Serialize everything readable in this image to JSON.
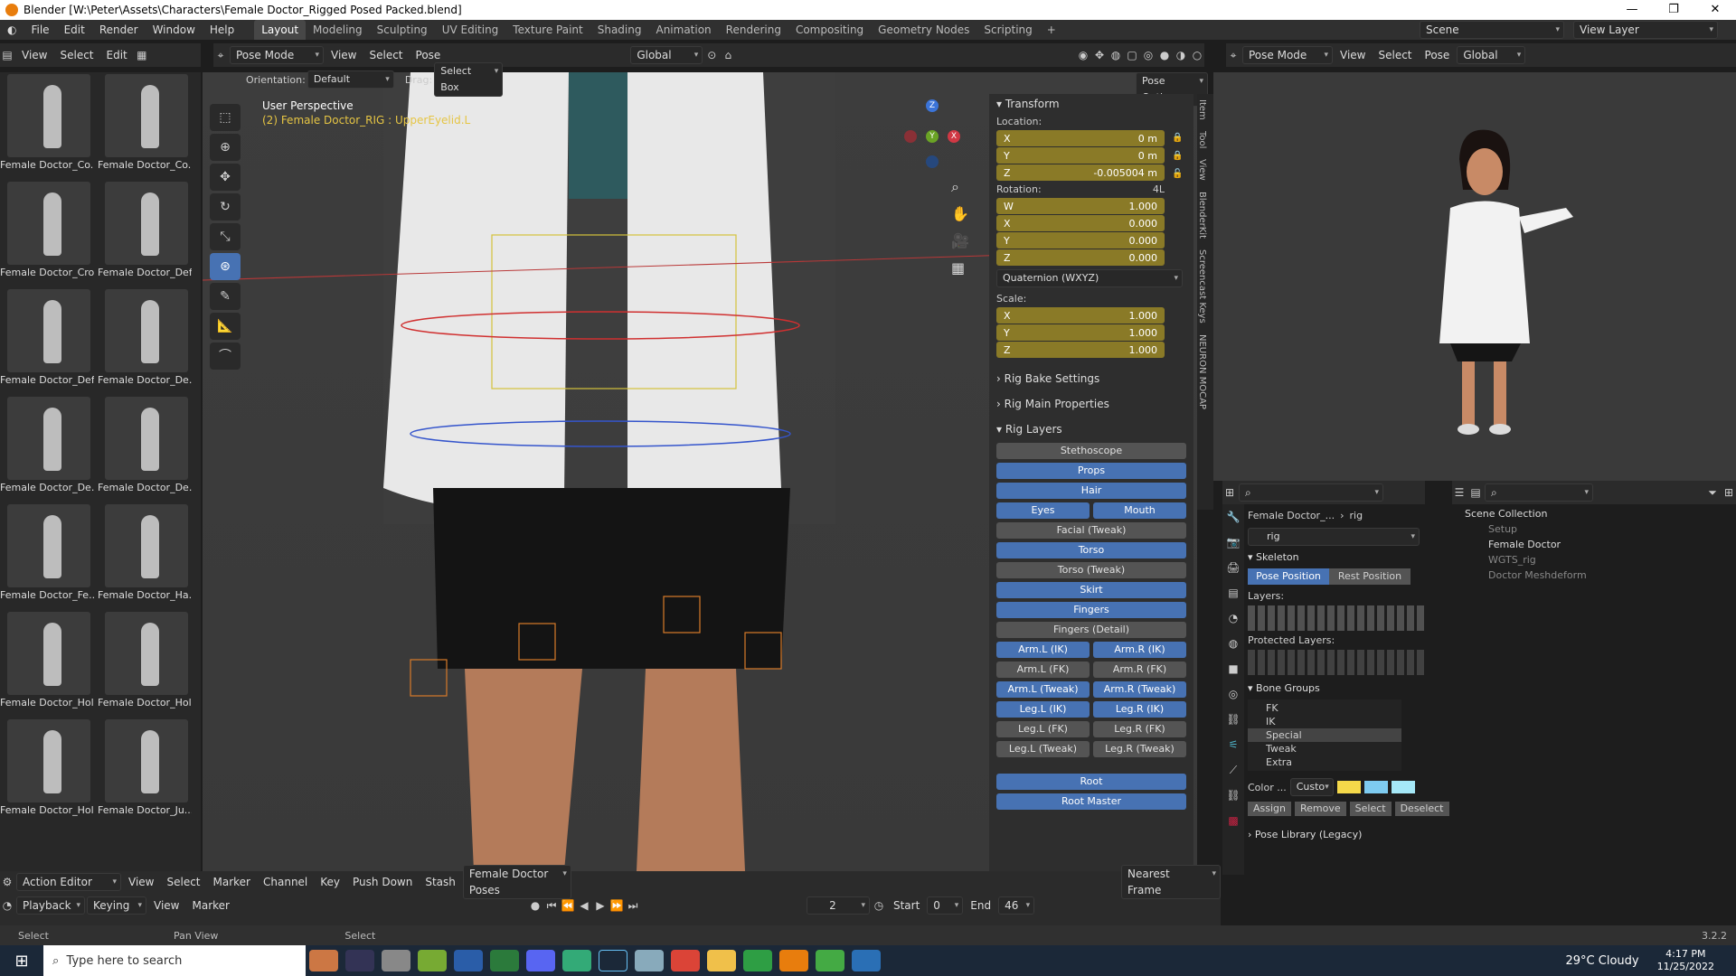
{
  "window": {
    "title": "Blender [W:\\Peter\\Assets\\Characters\\Female Doctor_Rigged Posed Packed.blend]"
  },
  "menu": [
    "File",
    "Edit",
    "Render",
    "Window",
    "Help"
  ],
  "workspaces": [
    "Layout",
    "Modeling",
    "Sculpting",
    "UV Editing",
    "Texture Paint",
    "Shading",
    "Animation",
    "Rendering",
    "Compositing",
    "Geometry Nodes",
    "Scripting"
  ],
  "active_workspace": "Layout",
  "scene": {
    "scene_label": "Scene",
    "view_layer_label": "View Layer"
  },
  "asset_header": {
    "view": "View",
    "select": "Select",
    "edit": "Edit"
  },
  "assets": [
    "Female Doctor_Co...",
    "Female Doctor_Co...",
    "Female Doctor_Cro",
    "Female Doctor_Def",
    "Female Doctor_Def",
    "Female Doctor_De...",
    "Female Doctor_De...",
    "Female Doctor_De...",
    "Female Doctor_Fe...",
    "Female Doctor_Ha...",
    "Female Doctor_Hol",
    "Female Doctor_Hol",
    "Female Doctor_Hol",
    "Female Doctor_Ju..."
  ],
  "viewport_header": {
    "mode": "Pose Mode",
    "view": "View",
    "select": "Select",
    "pose": "Pose",
    "transform": "Global"
  },
  "tool_settings": {
    "orientation_label": "Orientation:",
    "orientation": "Default",
    "drag_label": "Drag:",
    "drag": "Select Box",
    "pose_options": "Pose Options"
  },
  "overlay": {
    "perspective": "User Perspective",
    "object": "(2) Female Doctor_RIG : UpperEyelid.L"
  },
  "transform": {
    "title": "Transform",
    "location_label": "Location:",
    "location": [
      {
        "axis": "X",
        "value": "0 m"
      },
      {
        "axis": "Y",
        "value": "0 m"
      },
      {
        "axis": "Z",
        "value": "-0.005004 m"
      }
    ],
    "rotation_label": "Rotation:",
    "rotation_mode_tag": "4L",
    "rotation": [
      {
        "axis": "W",
        "value": "1.000"
      },
      {
        "axis": "X",
        "value": "0.000"
      },
      {
        "axis": "Y",
        "value": "0.000"
      },
      {
        "axis": "Z",
        "value": "0.000"
      }
    ],
    "rotation_mode": "Quaternion (WXYZ)",
    "scale_label": "Scale:",
    "scale": [
      {
        "axis": "X",
        "value": "1.000"
      },
      {
        "axis": "Y",
        "value": "1.000"
      },
      {
        "axis": "Z",
        "value": "1.000"
      }
    ]
  },
  "panels": {
    "bake": "Rig Bake Settings",
    "main": "Rig Main Properties",
    "layers": "Rig Layers"
  },
  "rig_layers": [
    {
      "label": "Stethoscope",
      "on": false,
      "full": true
    },
    {
      "label": "Props",
      "on": true,
      "full": true
    },
    {
      "label": "Hair",
      "on": true,
      "full": true
    },
    {
      "label": "Eyes",
      "on": true,
      "half": "left"
    },
    {
      "label": "Mouth",
      "on": true,
      "half": "right"
    },
    {
      "label": "Facial (Tweak)",
      "on": false,
      "full": true
    },
    {
      "label": "Torso",
      "on": true,
      "full": true
    },
    {
      "label": "Torso (Tweak)",
      "on": false,
      "full": true
    },
    {
      "label": "Skirt",
      "on": true,
      "full": true
    },
    {
      "label": "Fingers",
      "on": true,
      "full": true
    },
    {
      "label": "Fingers (Detail)",
      "on": false,
      "full": true
    },
    {
      "label": "Arm.L (IK)",
      "on": true,
      "half": "left"
    },
    {
      "label": "Arm.R (IK)",
      "on": true,
      "half": "right"
    },
    {
      "label": "Arm.L (FK)",
      "on": false,
      "half": "left"
    },
    {
      "label": "Arm.R (FK)",
      "on": false,
      "half": "right"
    },
    {
      "label": "Arm.L (Tweak)",
      "on": true,
      "half": "left"
    },
    {
      "label": "Arm.R (Tweak)",
      "on": true,
      "half": "right"
    },
    {
      "label": "Leg.L (IK)",
      "on": true,
      "half": "left"
    },
    {
      "label": "Leg.R (IK)",
      "on": true,
      "half": "right"
    },
    {
      "label": "Leg.L (FK)",
      "on": false,
      "half": "left"
    },
    {
      "label": "Leg.R (FK)",
      "on": false,
      "half": "right"
    },
    {
      "label": "Leg.L (Tweak)",
      "on": false,
      "half": "left"
    },
    {
      "label": "Leg.R (Tweak)",
      "on": false,
      "half": "right"
    },
    {
      "label": "Root",
      "on": true,
      "full": true,
      "gap": true
    },
    {
      "label": "Root Master",
      "on": true,
      "full": true
    }
  ],
  "side_tabs": [
    "Item",
    "Tool",
    "View",
    "BlenderKit",
    "Screencast Keys",
    "NEURON MOCAP"
  ],
  "right_header": {
    "mode": "Pose Mode",
    "view": "View",
    "select": "Select",
    "pose": "Pose",
    "transform": "Global"
  },
  "properties": {
    "breadcrumb_obj": "Female Doctor_...",
    "breadcrumb_data": "rig",
    "name_field": "rig",
    "skeleton": "Skeleton",
    "pose_position": "Pose Position",
    "rest_position": "Rest Position",
    "layers": "Layers:",
    "protected": "Protected Layers:",
    "bone_groups": "Bone Groups",
    "groups": [
      "FK",
      "IK",
      "Special",
      "Tweak",
      "Extra"
    ],
    "selected_group": "Special",
    "color_label": "Color ...",
    "color_value": "Custo",
    "colors": [
      "#f5d94a",
      "#7ecbf0",
      "#a5e8f7"
    ],
    "assign": "Assign",
    "remove": "Remove",
    "select": "Select",
    "deselect": "Deselect",
    "pose_library": "Pose Library (Legacy)"
  },
  "outliner": {
    "root": "Scene Collection",
    "items": [
      {
        "name": "Setup",
        "level": 1,
        "dim": true
      },
      {
        "name": "Female Doctor",
        "level": 1,
        "dim": false
      },
      {
        "name": "WGTS_rig",
        "level": 1,
        "dim": true
      },
      {
        "name": "Doctor Meshdeform",
        "level": 1,
        "dim": true
      }
    ]
  },
  "action_editor": {
    "mode": "Action Editor",
    "view": "View",
    "select": "Select",
    "marker": "Marker",
    "channel": "Channel",
    "key": "Key",
    "push_down": "Push Down",
    "stash": "Stash",
    "action": "Female Doctor Poses",
    "snap": "Nearest Frame"
  },
  "timeline": {
    "playback": "Playback",
    "keying": "Keying",
    "view": "View",
    "marker": "Marker",
    "frame": "2",
    "start_label": "Start",
    "start": "0",
    "end_label": "End",
    "end": "46"
  },
  "status": {
    "select": "Select",
    "pan": "Pan View",
    "select2": "Select",
    "version": "3.2.2"
  },
  "taskbar": {
    "search": "Type here to search",
    "weather": "29°C  Cloudy",
    "time": "4:17 PM",
    "date": "11/25/2022"
  }
}
